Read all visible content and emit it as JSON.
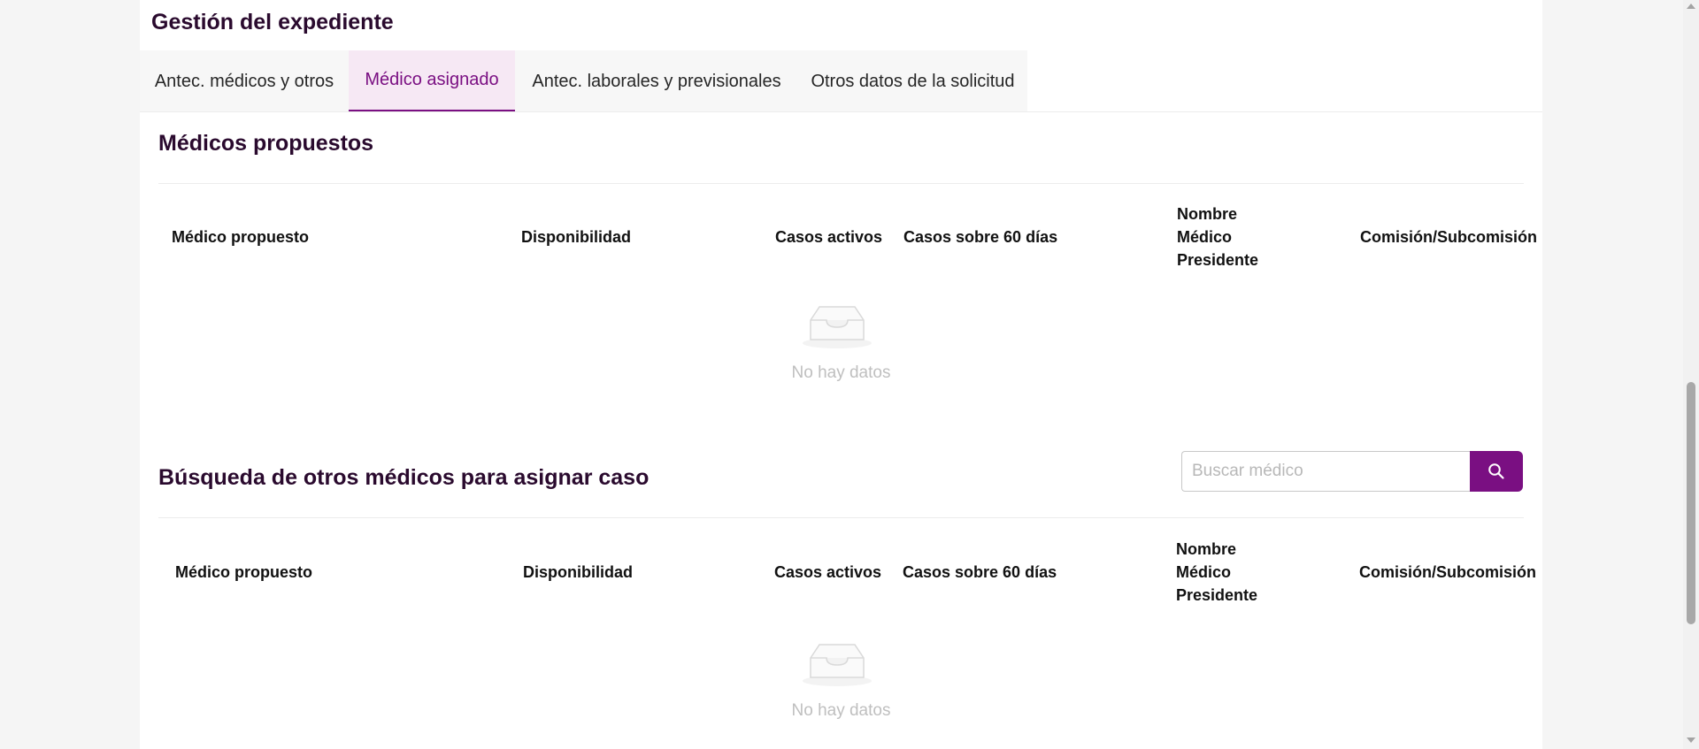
{
  "page": {
    "title": "Gestión del expediente"
  },
  "tabs": [
    {
      "label": "Antec. médicos y otros",
      "active": false
    },
    {
      "label": "Médico asignado",
      "active": true
    },
    {
      "label": "Antec. laborales y previsionales",
      "active": false
    },
    {
      "label": "Otros datos de la solicitud",
      "active": false
    }
  ],
  "proposed": {
    "title": "Médicos propuestos",
    "columns": [
      "Médico propuesto",
      "Disponibilidad",
      "Casos activos",
      "Casos sobre 60 días",
      "Nombre Médico Presidente",
      "Comisión/Subcomisión"
    ],
    "rows": [],
    "empty_text": "No hay datos",
    "empty_icon": "inbox-empty-icon"
  },
  "search_section": {
    "title": "Búsqueda de otros médicos para asignar caso",
    "search": {
      "value": "",
      "placeholder": "Buscar médico",
      "button_icon": "search-icon"
    },
    "columns": [
      "Médico propuesto",
      "Disponibilidad",
      "Casos activos",
      "Casos sobre 60 días",
      "Nombre Médico Presidente",
      "Comisión/Subcomisión"
    ],
    "rows": [],
    "empty_text": "No hay datos",
    "empty_icon": "inbox-empty-icon"
  },
  "colors": {
    "accent": "#7a0f82",
    "active_tab_bg": "#f6e8f4",
    "heading": "#2a0a2e",
    "muted_text": "#bfbfbf"
  }
}
